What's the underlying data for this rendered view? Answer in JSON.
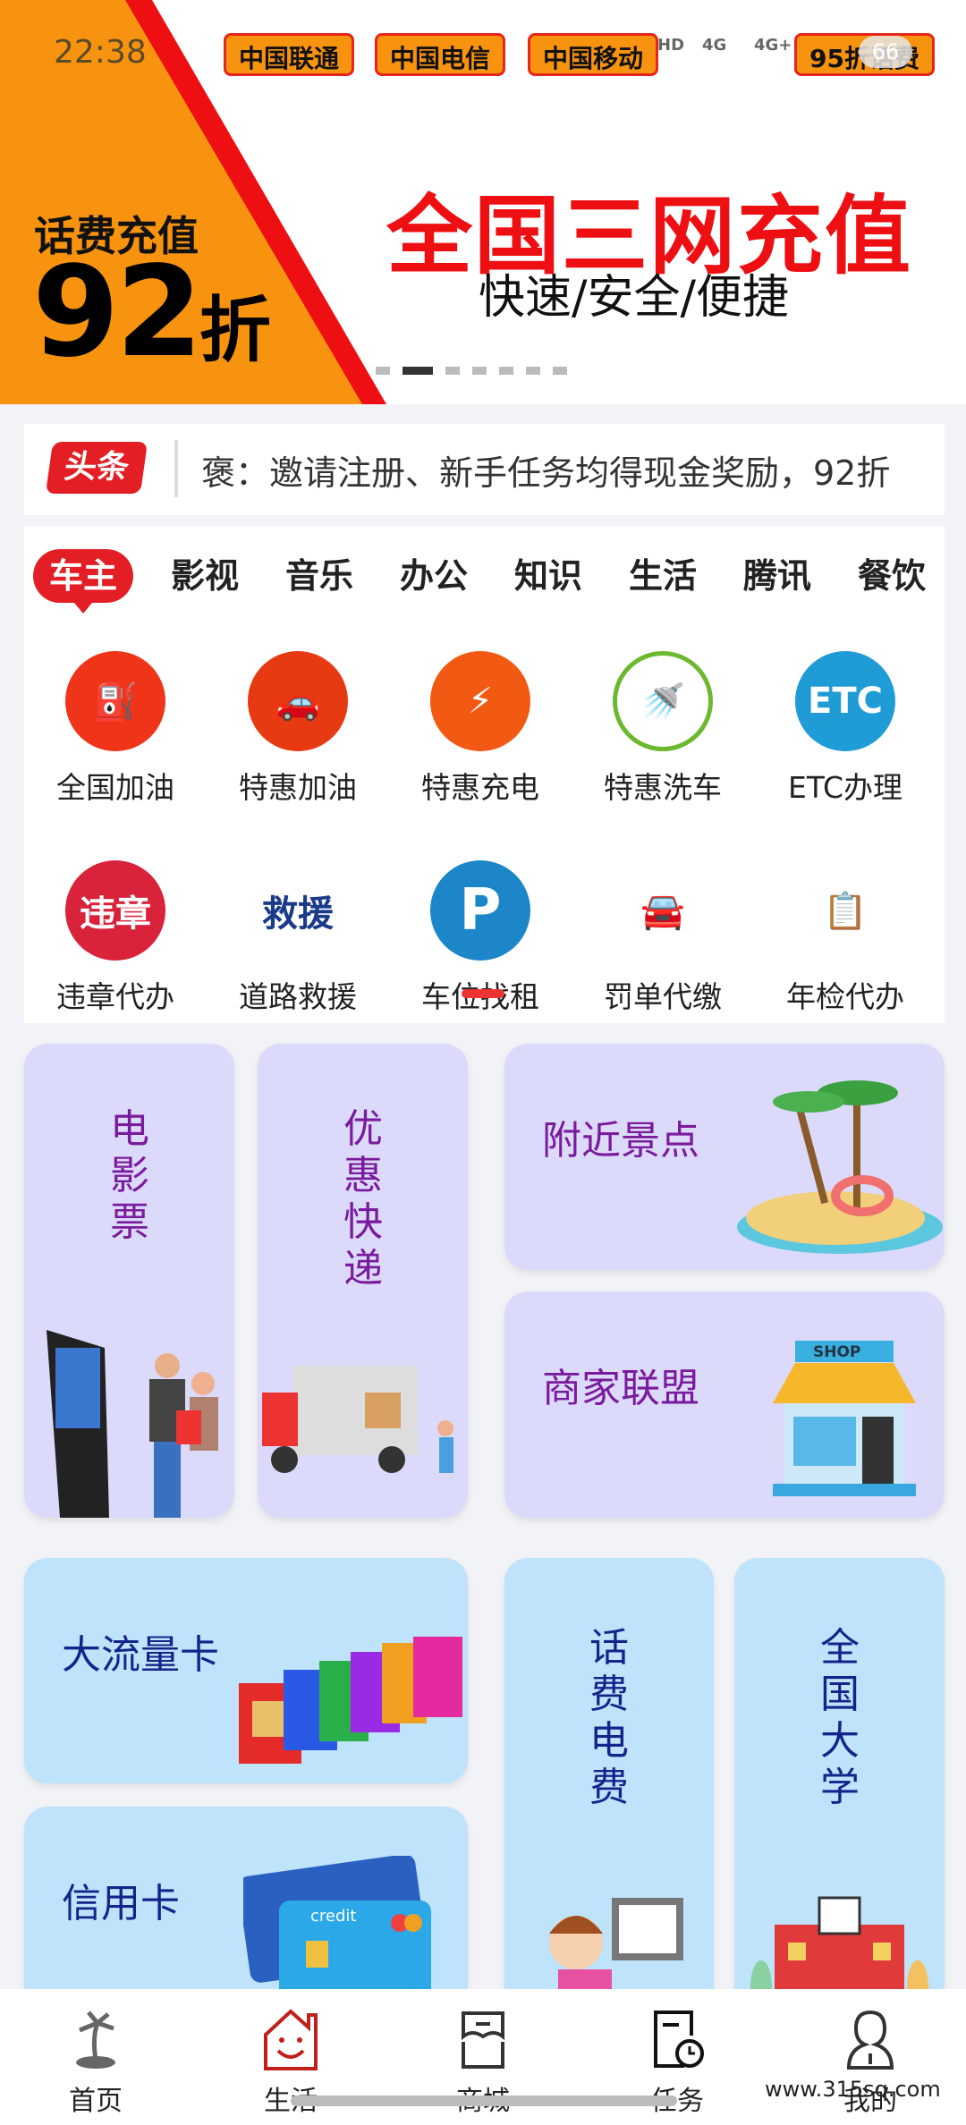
{
  "status_bar": {
    "time": "22:38",
    "network": [
      "HD",
      "4G",
      "4G+"
    ],
    "battery": "66"
  },
  "banner": {
    "carriers": [
      "中国联通",
      "中国电信",
      "中国移动",
      "95折话费"
    ],
    "promo_label": "话费充值",
    "promo_discount": "92",
    "promo_unit": "折",
    "headline": "全国三网充值",
    "subheadline": "快速/安全/便捷",
    "slides": 7,
    "active_slide": 2,
    "colors": {
      "orange": "#f7930e",
      "red": "#ee0f12"
    }
  },
  "notice": {
    "tag": "头条",
    "text": "褒：邀请注册、新手任务均得现金奖励，92折"
  },
  "categories": {
    "tabs": [
      "车主",
      "影视",
      "音乐",
      "办公",
      "知识",
      "生活",
      "腾讯",
      "餐饮"
    ],
    "active_tab": 0,
    "services": [
      {
        "label": "全国加油",
        "icon": "gas-pump-icon",
        "color": "#f0341a"
      },
      {
        "label": "特惠加油",
        "icon": "car-discount-icon",
        "color": "#e83a12"
      },
      {
        "label": "特惠充电",
        "icon": "charging-station-icon",
        "color": "#f25a14"
      },
      {
        "label": "特惠洗车",
        "icon": "car-wash-icon",
        "color": "#6cb92f"
      },
      {
        "label": "ETC办理",
        "icon": "etc-car-icon",
        "color": "#1f9bd6"
      },
      {
        "label": "违章代办",
        "icon": "violation-icon",
        "color": "#d8233a"
      },
      {
        "label": "道路救援",
        "icon": "rescue-icon",
        "color": "#1a3a8a"
      },
      {
        "label": "车位找租",
        "icon": "parking-icon",
        "color": "#1c86c8"
      },
      {
        "label": "罚单代缴",
        "icon": "fine-payment-icon",
        "color": "#e21f1f"
      },
      {
        "label": "年检代办",
        "icon": "inspection-icon",
        "color": "#3a8ee6"
      }
    ],
    "rescue_icon_text": "救援",
    "violation_icon_text": "违章",
    "etc_icon_text": "ETC"
  },
  "tiles": {
    "movie": "电影票",
    "express": "优惠快递",
    "scenic": "附近景点",
    "merchant": "商家联盟",
    "data_card": "大流量卡",
    "credit_card": "信用卡",
    "bills": "话费电费",
    "university": "全国大学",
    "shop_sign": "SHOP",
    "credit_text": "credit"
  },
  "bottom_nav": {
    "items": [
      "首页",
      "生活",
      "商城",
      "任务",
      "我的"
    ],
    "active": 1
  },
  "watermark": "www.315sq.com"
}
